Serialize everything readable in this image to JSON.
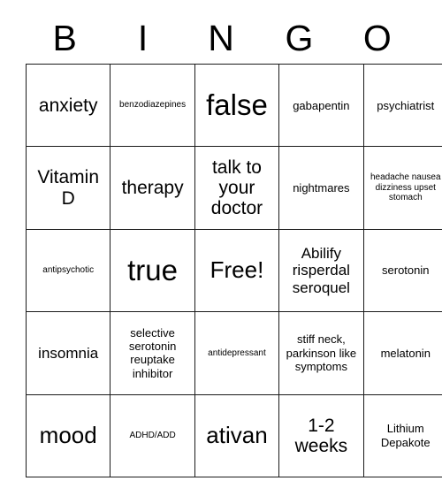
{
  "card": {
    "header_letters": [
      "B",
      "I",
      "N",
      "G",
      "O"
    ],
    "free_space_label": "Free!",
    "grid_line_color": "#1a1a1a",
    "background_color": "#ffffff",
    "text_color": "#000000",
    "rows": [
      [
        {
          "text": "anxiety",
          "size": "sz-lg"
        },
        {
          "text": "benzodiazepines",
          "size": "sz-xs"
        },
        {
          "text": "false",
          "size": "sz-xxl"
        },
        {
          "text": "gabapentin",
          "size": "sz-sm"
        },
        {
          "text": "psychiatrist",
          "size": "sz-sm"
        }
      ],
      [
        {
          "text": "Vitamin D",
          "size": "sz-lg"
        },
        {
          "text": "therapy",
          "size": "sz-lg"
        },
        {
          "text": "talk to your doctor",
          "size": "sz-lg"
        },
        {
          "text": "nightmares",
          "size": "sz-sm"
        },
        {
          "text": "headache nausea dizziness upset stomach",
          "size": "sz-xs"
        }
      ],
      [
        {
          "text": "antipsychotic",
          "size": "sz-xs"
        },
        {
          "text": "true",
          "size": "sz-xxl"
        },
        {
          "text": "Free!",
          "size": "sz-xl"
        },
        {
          "text": "Abilify risperdal seroquel",
          "size": "sz-md"
        },
        {
          "text": "serotonin",
          "size": "sz-sm"
        }
      ],
      [
        {
          "text": "insomnia",
          "size": "sz-md"
        },
        {
          "text": "selective serotonin reuptake inhibitor",
          "size": "sz-sm"
        },
        {
          "text": "antidepressant",
          "size": "sz-xs"
        },
        {
          "text": "stiff neck, parkinson like symptoms",
          "size": "sz-sm"
        },
        {
          "text": "melatonin",
          "size": "sz-sm"
        }
      ],
      [
        {
          "text": "mood",
          "size": "sz-xl"
        },
        {
          "text": "ADHD/ADD",
          "size": "sz-xs"
        },
        {
          "text": "ativan",
          "size": "sz-xl"
        },
        {
          "text": "1-2 weeks",
          "size": "sz-lg"
        },
        {
          "text": "Lithium Depakote",
          "size": "sz-sm"
        }
      ]
    ]
  }
}
